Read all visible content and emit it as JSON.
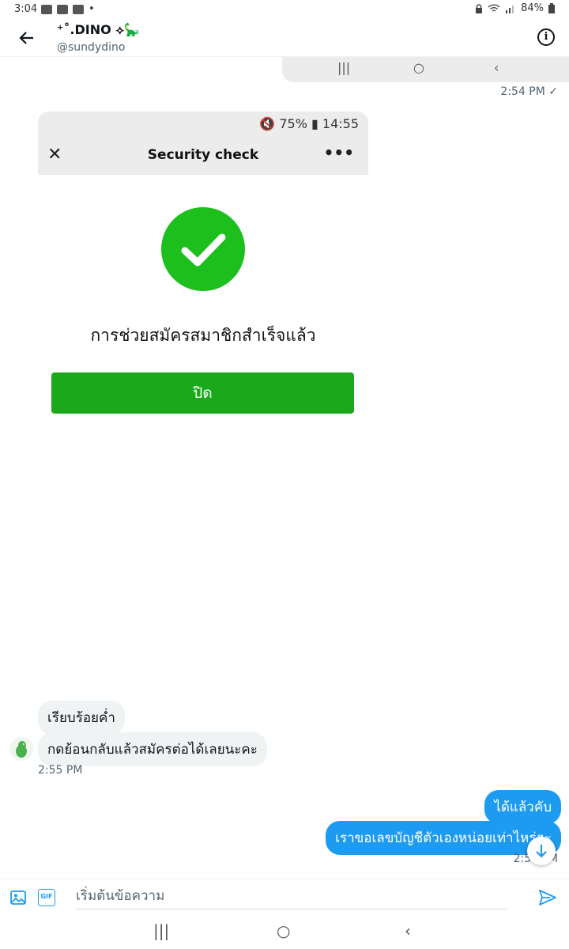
{
  "status_bar": {
    "time": "3:04",
    "battery": "84%"
  },
  "header": {
    "name": "⁺˚.DINO ⟡🦕",
    "handle": "@sundydino"
  },
  "nav_glyphs": {
    "recents": "|||",
    "home": "○",
    "back": "‹"
  },
  "messages": {
    "sent_screenshot_time": "2:54 PM ✓",
    "screenshot": {
      "status": "🔇 75% ▮ 14:55",
      "title": "Security check",
      "close_glyph": "✕",
      "more_glyph": "•••",
      "success_text": "การช่วยสมัครสมาชิกสำเร็จแล้ว",
      "button_label": "ปิด"
    },
    "received": [
      "เรียบร้อยค่ำ",
      "กดย้อนกลับแล้วสมัครต่อได้เลยนะคะ"
    ],
    "received_time": "2:55 PM",
    "sent": [
      "ได้แล้วคับ",
      "เราขอเลขบัญชีตัวเองหน่อยเท่าไหร่ฮะ"
    ],
    "sent_time": "2:59 PM"
  },
  "composer": {
    "placeholder": "เริ่มต้นข้อความ",
    "gif_label": "GIF"
  },
  "colors": {
    "accent": "#1d9bf0",
    "success": "#1cbf1c",
    "button_green": "#1ba91b"
  }
}
